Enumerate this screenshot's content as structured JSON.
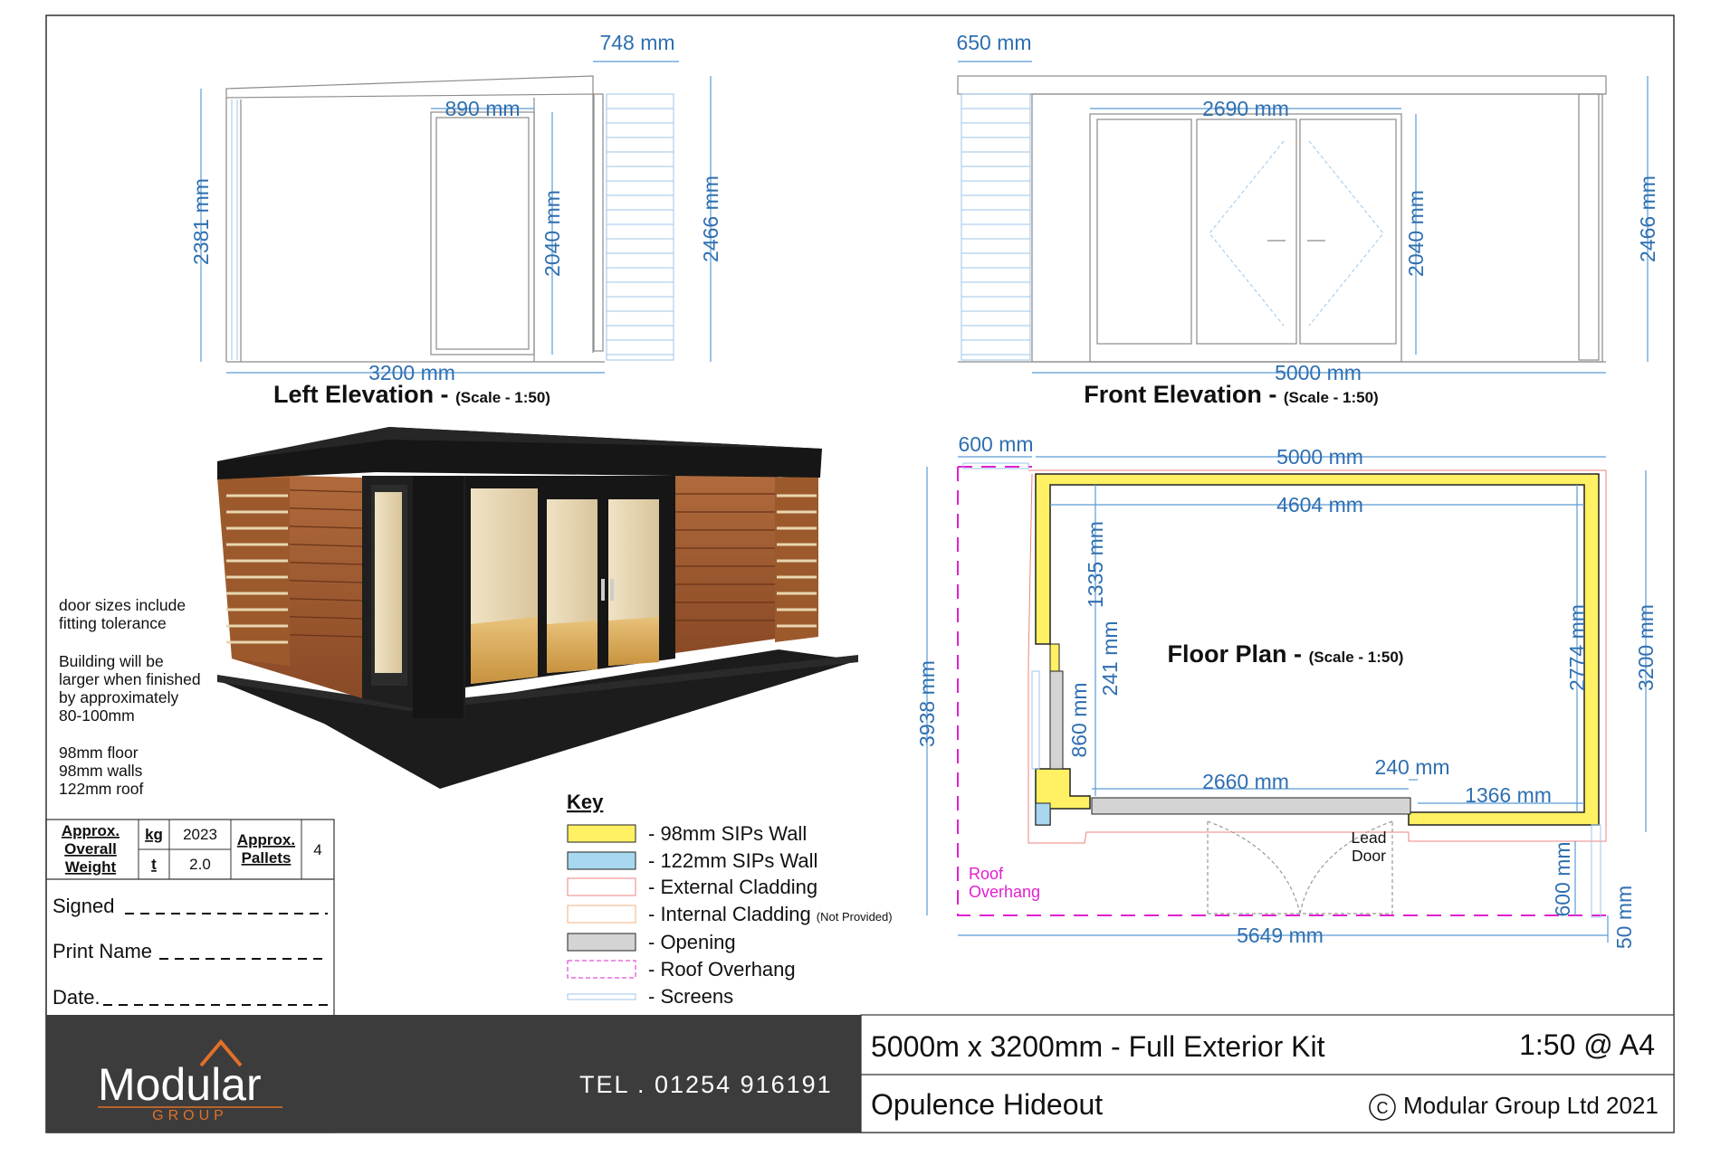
{
  "left_elevation": {
    "title": "Left Elevation - ",
    "scale": "(Scale - 1:50)",
    "dims": {
      "top_canopy": "748 mm",
      "door_width": "890 mm",
      "height_left": "2381 mm",
      "door_height": "2040 mm",
      "height_right": "2466 mm",
      "width": "3200 mm"
    }
  },
  "front_elevation": {
    "title": "Front Elevation - ",
    "scale": "(Scale - 1:50)",
    "dims": {
      "screen_width": "650 mm",
      "doors_width": "2690 mm",
      "door_height": "2040 mm",
      "height": "2466 mm",
      "width": "5000 mm"
    }
  },
  "floor_plan": {
    "title": "Floor Plan - ",
    "scale": "(Scale - 1:50)",
    "dims": {
      "overhang_left": "600 mm",
      "outer_width": "5000 mm",
      "inner_width": "4604 mm",
      "d1335": "1335 mm",
      "d241": "241 mm",
      "d860": "860 mm",
      "d2774": "2774 mm",
      "outer_depth": "3200 mm",
      "overall_depth": "3938 mm",
      "opening": "2660 mm",
      "d240": "240 mm",
      "d1366": "1366 mm",
      "d600": "600 mm",
      "d50": "50 mm",
      "overall_width": "5649 mm"
    },
    "roof_overhang_label": [
      "Roof",
      "Overhang"
    ],
    "lead_door_label": [
      "Lead",
      "Door"
    ]
  },
  "notes": [
    "door sizes include",
    "fitting tolerance",
    "",
    "Building will be",
    "larger when finished",
    "by approximately",
    "80-100mm",
    "",
    "98mm floor",
    "98mm walls",
    "122mm roof"
  ],
  "weight_table": {
    "label": [
      "Approx.",
      "Overall",
      "Weight"
    ],
    "unit_kg": "kg",
    "value_kg": "2023",
    "unit_t": "t",
    "value_t": "2.0",
    "pallets_label": [
      "Approx.",
      "Pallets"
    ],
    "pallets_value": "4"
  },
  "signatures": {
    "signed": "Signed",
    "print_name": "Print Name",
    "date": "Date."
  },
  "key": {
    "title": "Key",
    "items": [
      {
        "label": "- 98mm SIPs Wall",
        "swatch": "#fff064",
        "stroke": "#222222"
      },
      {
        "label": "- 122mm SIPs Wall",
        "swatch": "#a8d8f0",
        "stroke": "#222222"
      },
      {
        "label": "- External Cladding",
        "swatch": "#ffffff",
        "stroke": "#f08080"
      },
      {
        "label": "- Internal Cladding",
        "note": "(Not Provided)",
        "swatch": "#ffffff",
        "stroke": "#f0b080"
      },
      {
        "label": "- Opening",
        "swatch": "#d4d4d4",
        "stroke": "#222222"
      },
      {
        "label": "- Roof Overhang",
        "swatch": "#ffffff",
        "stroke": "#e020d0"
      },
      {
        "label": "- Screens",
        "swatch": "#ffffff",
        "stroke": "#9cc6e8"
      }
    ]
  },
  "footer": {
    "logo_main": "Modular",
    "logo_sub": "GROUP",
    "tel": "TEL . 01254 916191",
    "product": "5000m x 3200mm - Full Exterior Kit",
    "scale": "1:50 @ A4",
    "name": "Opulence Hideout",
    "copyright_symbol": "C",
    "copyright": "Modular Group Ltd 2021"
  },
  "colors": {
    "dimension": "#2f6fb0",
    "sips98": "#fff064",
    "sips122": "#a8d8f0",
    "overhang": "#e020d0",
    "footer_dark": "#3d3c3c",
    "logo_orange": "#e0702a"
  }
}
